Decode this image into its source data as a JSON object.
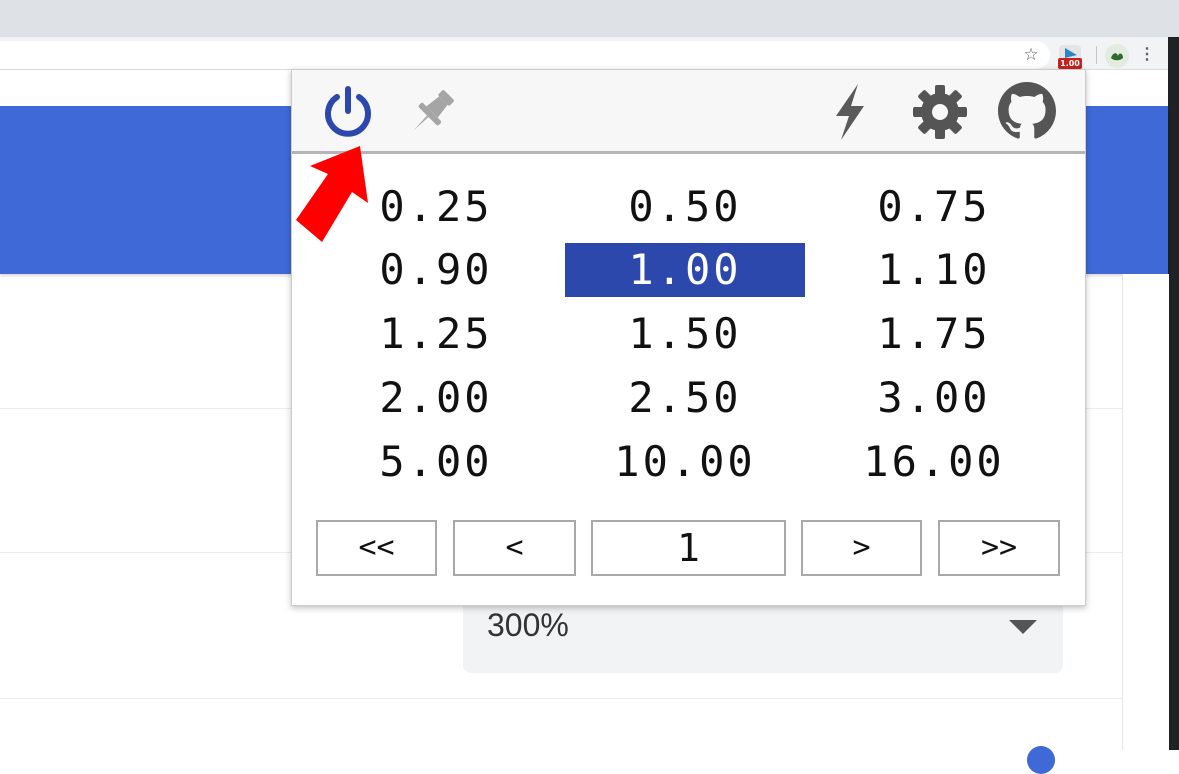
{
  "browser": {
    "extension_badge": "1.00",
    "icons": [
      "star-icon",
      "speed-extension-icon",
      "profile-avatar",
      "kebab-menu-icon"
    ]
  },
  "popup": {
    "toolbar_icons": [
      "power-icon",
      "pin-icon",
      "bolt-icon",
      "gear-icon",
      "github-icon"
    ],
    "speeds": [
      [
        "0.25",
        "0.50",
        "0.75"
      ],
      [
        "0.90",
        "1.00",
        "1.10"
      ],
      [
        "1.25",
        "1.50",
        "1.75"
      ],
      [
        "2.00",
        "2.50",
        "3.00"
      ],
      [
        "5.00",
        "10.00",
        "16.00"
      ]
    ],
    "selected_speed": "1.00",
    "nav": {
      "first": "<<",
      "prev": "<",
      "value": "1",
      "next": ">",
      "last": ">>"
    }
  },
  "page": {
    "select_value": "300%"
  },
  "colors": {
    "accent": "#3f69d7",
    "selected": "#2c48ad",
    "power": "#2c48ad",
    "annotation": "#ff0000"
  }
}
